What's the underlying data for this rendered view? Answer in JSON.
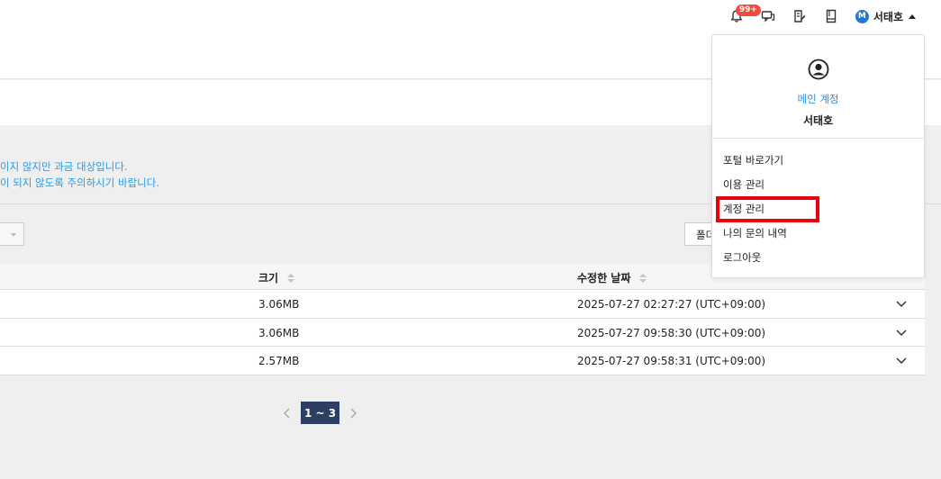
{
  "header": {
    "notification_badge": "99+",
    "user_initial": "M",
    "user_name": "서태호",
    "icons": [
      "bell-icon",
      "chat-icon",
      "memo-icon",
      "book-icon"
    ]
  },
  "notice": {
    "line1": "이지 않지만 과금 대상입니다.",
    "line2": "이 되지 않도록 주의하시기 바랍니다."
  },
  "toolbar": {
    "folder_button_label": "폴더"
  },
  "table": {
    "columns": [
      "크기",
      "수정한 날짜"
    ],
    "rows": [
      {
        "size": "3.06MB",
        "modified": "2025-07-27 02:27:27 (UTC+09:00)"
      },
      {
        "size": "3.06MB",
        "modified": "2025-07-27 09:58:30 (UTC+09:00)"
      },
      {
        "size": "2.57MB",
        "modified": "2025-07-27 09:58:31 (UTC+09:00)"
      }
    ]
  },
  "pagination": {
    "current": "1 ~ 3"
  },
  "user_menu": {
    "role": "메인 계정",
    "name": "서태호",
    "items": [
      "포털 바로가기",
      "이용 관리",
      "계정 관리",
      "나의 문의 내역",
      "로그아웃"
    ]
  },
  "colors": {
    "accent_blue": "#2b8fd6",
    "notice_blue": "#2b9be0",
    "badge_red": "#ef4b3e",
    "highlight_red": "#e8000c",
    "pager_navy": "#2d3e63"
  }
}
